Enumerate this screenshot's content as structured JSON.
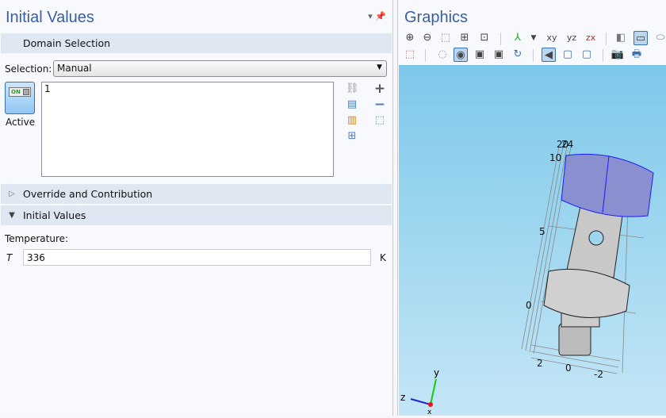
{
  "settings": {
    "title": "Initial Values",
    "domain_section": "Domain Selection",
    "selection_label": "Selection:",
    "selection_value": "Manual",
    "active_label": "Active",
    "toggle_text": "ON",
    "selected_domains": "1",
    "override_section": "Override and Contribution",
    "initial_section": "Initial Values",
    "temperature_label": "Temperature:",
    "temperature_symbol": "T",
    "temperature_value": "336",
    "temperature_unit": "K"
  },
  "graphics": {
    "title": "Graphics",
    "toolbar_row1": [
      "zoom-in-icon",
      "zoom-out-icon",
      "zoom-box-icon",
      "zoom-selected-icon",
      "zoom-extents-icon",
      "axes-view-icon",
      "xy-view",
      "yz-view",
      "zx-view",
      "scene-light-icon",
      "transparency-icon",
      "render-wireframe-icon"
    ],
    "toolbar_row1_labels": {
      "xy": "xy",
      "yz": "yz",
      "zx": "zx"
    },
    "axis_ticks": {
      "z_top_a": "20",
      "z_top_b": "24",
      "z10": "10",
      "z5": "5",
      "z0": "0",
      "x2": "2",
      "x0": "0",
      "xm2": "-2"
    },
    "triad": {
      "x": "x",
      "y": "y",
      "z": "z"
    },
    "colors": {
      "selected_domain": "#8a8fd0",
      "edge_highlight": "#1a1aff",
      "background_top": "#7dc8ea",
      "background_bottom": "#c4e6f6"
    }
  }
}
